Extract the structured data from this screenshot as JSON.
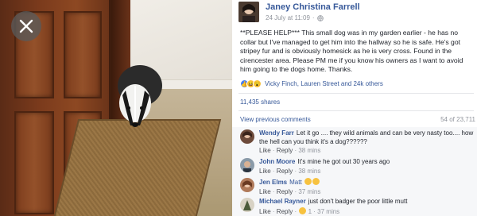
{
  "viewer": {
    "close_label": "Close"
  },
  "post": {
    "author": "Janey Christina Farrell",
    "date": "24 July at 11:09",
    "meta_sep": "·",
    "text": "**PLEASE HELP*** This small dog was in my garden earlier - he has no collar but I've managed to get him into the hallway so he is safe. He's got stripey fur and is obviously homesick as he is very cross. Found in the cirencester area. Please PM me if you know his owners as I want to avoid him going to the dogs home. Thanks.",
    "reaction_names": "Vicky Finch, Lauren Street and 24k others",
    "shares": "11,435 shares",
    "view_previous": "View previous comments",
    "comment_count": "54 of 23,711"
  },
  "colors": {
    "link": "#365899",
    "text": "#1d2129",
    "muted": "#90949c",
    "comments_bg": "#f6f7f9"
  },
  "comments": [
    {
      "name": "Wendy Farr",
      "text": "Let it go .... they wild animals and can be very nasty too.... how the hell can you think it's a dog??????",
      "like": "Like",
      "reply": "Reply",
      "time": "38 mins"
    },
    {
      "name": "John Moore",
      "text": "It's mine he got out 30 years ago",
      "like": "Like",
      "reply": "Reply",
      "time": "38 mins"
    },
    {
      "name": "Jen Elms",
      "mention": "Matt",
      "like": "Like",
      "reply": "Reply",
      "time": "37 mins"
    },
    {
      "name": "Michael Rayner",
      "text": "just don't badger the poor little mutt",
      "like": "Like",
      "reply": "Reply",
      "reaction_count": "1",
      "time": "37 mins"
    }
  ]
}
